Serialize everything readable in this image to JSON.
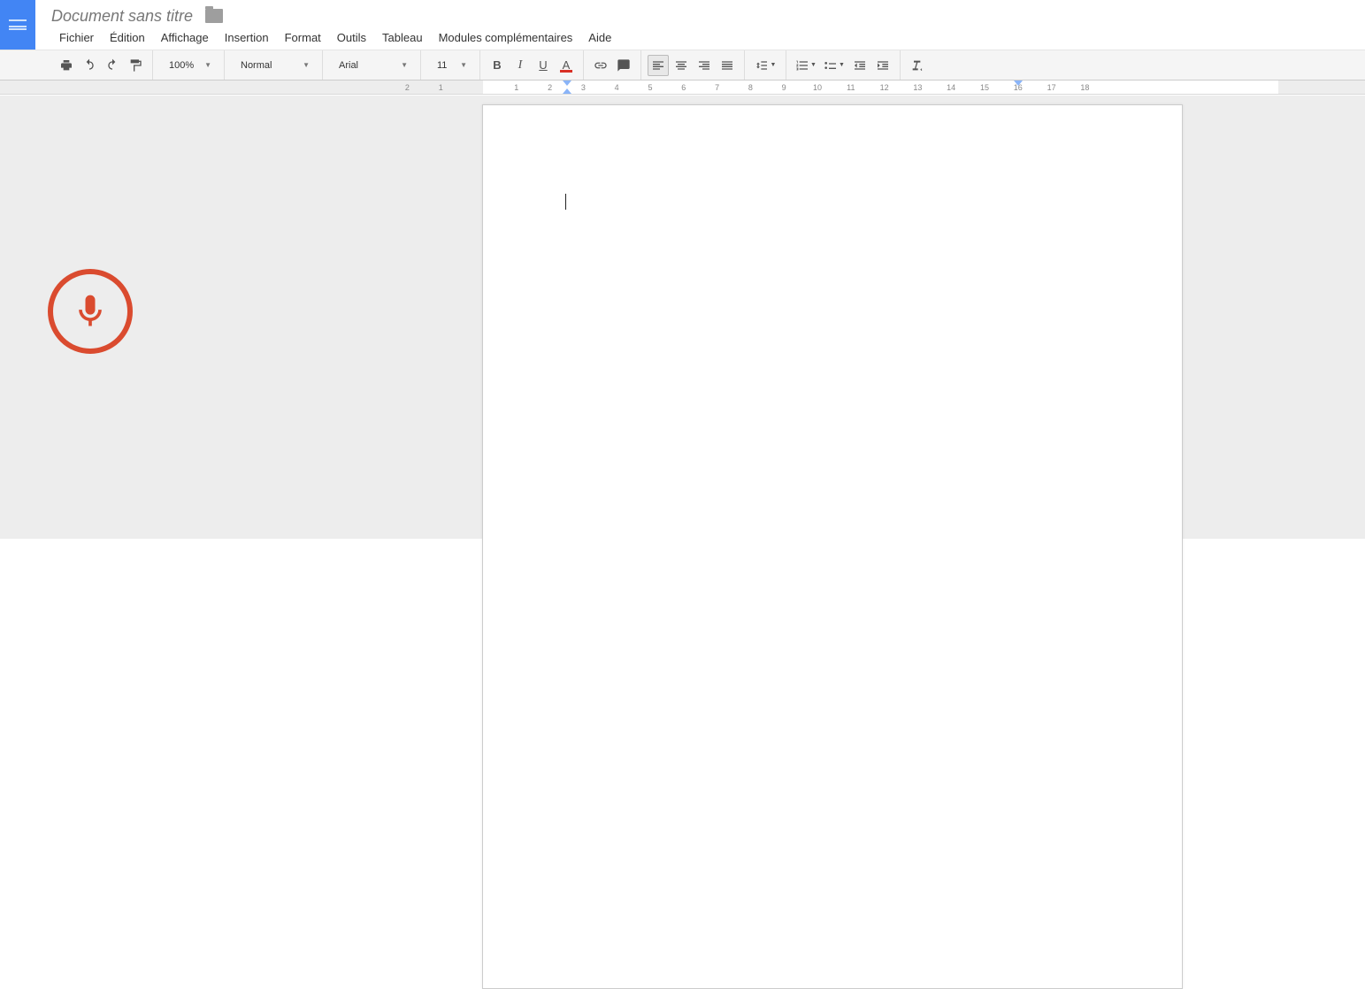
{
  "header": {
    "title": "Document sans titre"
  },
  "menu": {
    "items": [
      "Fichier",
      "Édition",
      "Affichage",
      "Insertion",
      "Format",
      "Outils",
      "Tableau",
      "Modules complémentaires",
      "Aide"
    ]
  },
  "toolbar": {
    "zoom": "100%",
    "style": "Normal",
    "font": "Arial",
    "size": "11",
    "icons": {
      "print": "print-icon",
      "undo": "undo-icon",
      "redo": "redo-icon",
      "paint": "paint-format-icon",
      "bold": "bold-icon",
      "italic": "italic-icon",
      "underline": "underline-icon",
      "text_color": "text-color-icon",
      "link": "link-icon",
      "comment": "comment-icon",
      "align_left": "align-left-icon",
      "align_center": "align-center-icon",
      "align_right": "align-right-icon",
      "align_justify": "align-justify-icon",
      "line_spacing": "line-spacing-icon",
      "list_number": "numbered-list-icon",
      "list_bullet": "bulleted-list-icon",
      "indent_decrease": "indent-decrease-icon",
      "indent_increase": "indent-increase-icon",
      "clear_format": "clear-formatting-icon"
    }
  },
  "ruler": {
    "negative_ticks": [
      2,
      1
    ],
    "ticks": [
      1,
      2,
      3,
      4,
      5,
      6,
      7,
      8,
      9,
      10,
      11,
      12,
      13,
      14,
      15,
      16,
      17,
      18
    ],
    "left_indent_cm": 2.5,
    "right_margin_cm": 16
  },
  "voice": {
    "icon": "microphone-icon"
  },
  "colors": {
    "accent": "#4285f4",
    "mic": "#da4b2f",
    "text_underline": "#d93025"
  }
}
